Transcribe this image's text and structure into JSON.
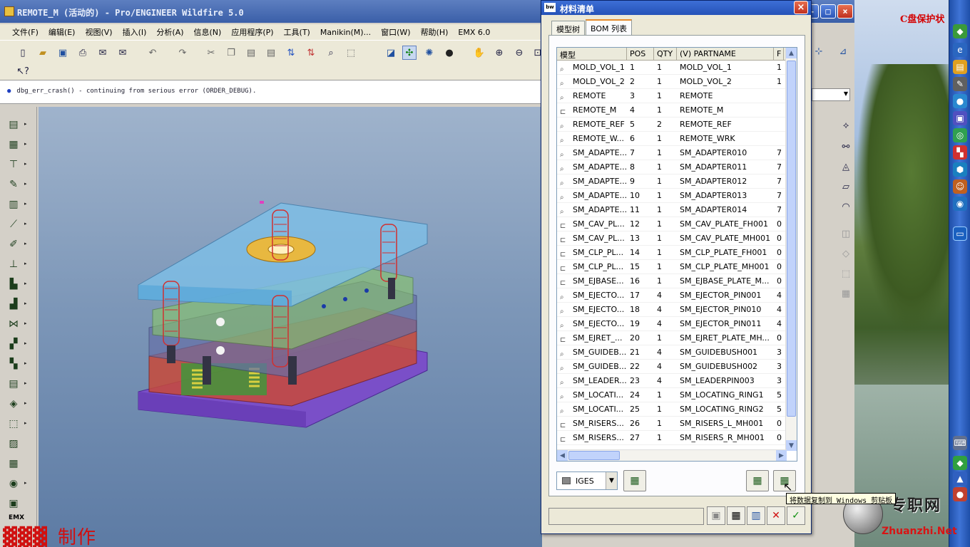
{
  "main_window": {
    "title": "REMOTE_M (活动的) - Pro/ENGINEER Wildfire 5.0",
    "menu": [
      "文件(F)",
      "编辑(E)",
      "视图(V)",
      "插入(I)",
      "分析(A)",
      "信息(N)",
      "应用程序(P)",
      "工具(T)",
      "Manikin(M)...",
      "窗口(W)",
      "帮助(H)",
      "EMX 6.0"
    ],
    "message": "dbg_err_crash() - continuing from serious error (ORDER_DEBUG).",
    "left_toolbar_footer": "EMX"
  },
  "desktop": {
    "protect_label": "C盘保护状"
  },
  "dialog": {
    "title": "材料清单",
    "icon_label": "bw",
    "tabs": [
      "模型树",
      "BOM 列表"
    ],
    "active_tab": 1,
    "columns": [
      "模型",
      "POS",
      "QTY",
      "(V) PARTNAME",
      "F"
    ],
    "rows": [
      {
        "model": "MOLD_VOL_1",
        "pos": "1",
        "qty": "1",
        "partname": "MOLD_VOL_1",
        "extra": "1",
        "icon": "part"
      },
      {
        "model": "MOLD_VOL_2",
        "pos": "2",
        "qty": "1",
        "partname": "MOLD_VOL_2",
        "extra": "1",
        "icon": "part"
      },
      {
        "model": "REMOTE",
        "pos": "3",
        "qty": "1",
        "partname": "REMOTE",
        "extra": "",
        "icon": "part"
      },
      {
        "model": "REMOTE_M",
        "pos": "4",
        "qty": "1",
        "partname": "REMOTE_M",
        "extra": "",
        "icon": "asm"
      },
      {
        "model": "REMOTE_REF",
        "pos": "5",
        "qty": "2",
        "partname": "REMOTE_REF",
        "extra": "",
        "icon": "part"
      },
      {
        "model": "REMOTE_W...",
        "pos": "6",
        "qty": "1",
        "partname": "REMOTE_WRK",
        "extra": "",
        "icon": "part"
      },
      {
        "model": "SM_ADAPTE...",
        "pos": "7",
        "qty": "1",
        "partname": "SM_ADAPTER010",
        "extra": "7",
        "icon": "part"
      },
      {
        "model": "SM_ADAPTE...",
        "pos": "8",
        "qty": "1",
        "partname": "SM_ADAPTER011",
        "extra": "7",
        "icon": "part"
      },
      {
        "model": "SM_ADAPTE...",
        "pos": "9",
        "qty": "1",
        "partname": "SM_ADAPTER012",
        "extra": "7",
        "icon": "part"
      },
      {
        "model": "SM_ADAPTE...",
        "pos": "10",
        "qty": "1",
        "partname": "SM_ADAPTER013",
        "extra": "7",
        "icon": "part"
      },
      {
        "model": "SM_ADAPTE...",
        "pos": "11",
        "qty": "1",
        "partname": "SM_ADAPTER014",
        "extra": "7",
        "icon": "part"
      },
      {
        "model": "SM_CAV_PL...",
        "pos": "12",
        "qty": "1",
        "partname": "SM_CAV_PLATE_FH001",
        "extra": "0",
        "icon": "asm"
      },
      {
        "model": "SM_CAV_PL...",
        "pos": "13",
        "qty": "1",
        "partname": "SM_CAV_PLATE_MH001",
        "extra": "0",
        "icon": "asm"
      },
      {
        "model": "SM_CLP_PL...",
        "pos": "14",
        "qty": "1",
        "partname": "SM_CLP_PLATE_FH001",
        "extra": "0",
        "icon": "asm"
      },
      {
        "model": "SM_CLP_PL...",
        "pos": "15",
        "qty": "1",
        "partname": "SM_CLP_PLATE_MH001",
        "extra": "0",
        "icon": "asm"
      },
      {
        "model": "SM_EJBASE...",
        "pos": "16",
        "qty": "1",
        "partname": "SM_EJBASE_PLATE_M...",
        "extra": "0",
        "icon": "asm"
      },
      {
        "model": "SM_EJECTO...",
        "pos": "17",
        "qty": "4",
        "partname": "SM_EJECTOR_PIN001",
        "extra": "4",
        "icon": "part"
      },
      {
        "model": "SM_EJECTO...",
        "pos": "18",
        "qty": "4",
        "partname": "SM_EJECTOR_PIN010",
        "extra": "4",
        "icon": "part"
      },
      {
        "model": "SM_EJECTO...",
        "pos": "19",
        "qty": "4",
        "partname": "SM_EJECTOR_PIN011",
        "extra": "4",
        "icon": "part"
      },
      {
        "model": "SM_EJRET_...",
        "pos": "20",
        "qty": "1",
        "partname": "SM_EJRET_PLATE_MH...",
        "extra": "0",
        "icon": "asm"
      },
      {
        "model": "SM_GUIDEB...",
        "pos": "21",
        "qty": "4",
        "partname": "SM_GUIDEBUSH001",
        "extra": "3",
        "icon": "part"
      },
      {
        "model": "SM_GUIDEB...",
        "pos": "22",
        "qty": "4",
        "partname": "SM_GUIDEBUSH002",
        "extra": "3",
        "icon": "part"
      },
      {
        "model": "SM_LEADER...",
        "pos": "23",
        "qty": "4",
        "partname": "SM_LEADERPIN003",
        "extra": "3",
        "icon": "part"
      },
      {
        "model": "SM_LOCATI...",
        "pos": "24",
        "qty": "1",
        "partname": "SM_LOCATING_RING1",
        "extra": "5",
        "icon": "part"
      },
      {
        "model": "SM_LOCATI...",
        "pos": "25",
        "qty": "1",
        "partname": "SM_LOCATING_RING2",
        "extra": "5",
        "icon": "part"
      },
      {
        "model": "SM_RISERS...",
        "pos": "26",
        "qty": "1",
        "partname": "SM_RISERS_L_MH001",
        "extra": "0",
        "icon": "asm"
      },
      {
        "model": "SM_RISERS...",
        "pos": "27",
        "qty": "1",
        "partname": "SM_RISERS_R_MH001",
        "extra": "0",
        "icon": "asm"
      }
    ],
    "format_value": "IGES",
    "tooltip": "将数据复制到 Windows 剪贴板"
  },
  "brand": {
    "author": "▓▓▓",
    "made": "制作"
  },
  "watermark": {
    "cn": "专职网",
    "en": "Zhuanzhi.Net"
  },
  "colors": {
    "titlebar": "#3a5fa8",
    "dialog_title": "#2552b8",
    "active_tab_border": "#e68b2c",
    "brand_red": "#d01010"
  }
}
